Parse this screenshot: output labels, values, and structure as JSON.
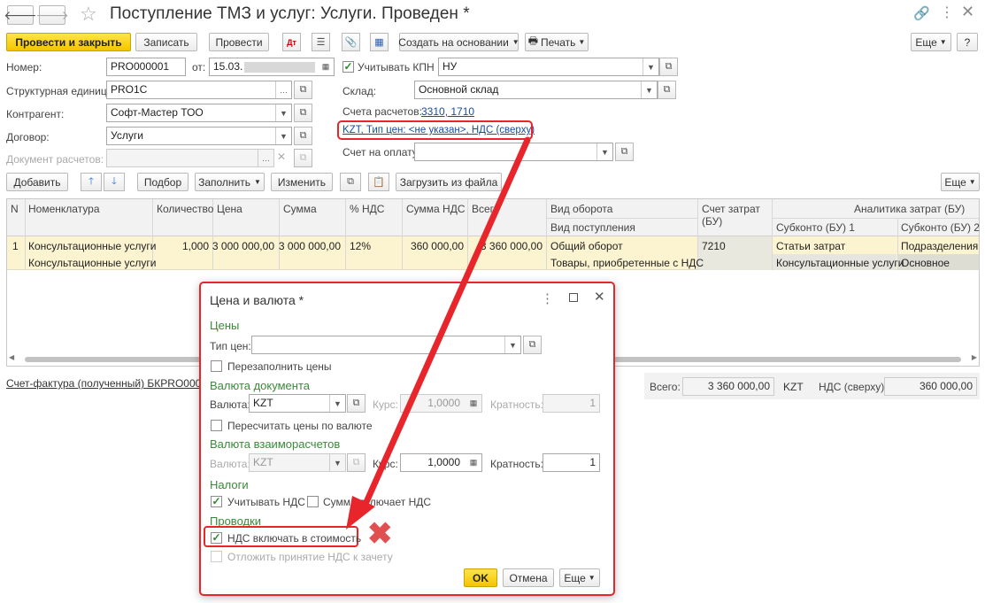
{
  "window": {
    "title": "Поступление ТМЗ и услуг: Услуги. Проведен *"
  },
  "toolbar": {
    "post_close": "Провести и закрыть",
    "save": "Записать",
    "post": "Провести",
    "create_based": "Создать на основании",
    "print": "Печать",
    "more": "Еще",
    "help": "?"
  },
  "form": {
    "number_label": "Номер:",
    "number_value": "PRO000001",
    "date_label": "от:",
    "date_value": "15.03.",
    "kpn_label": "Учитывать КПН",
    "kpn_value": "НУ",
    "unit_label": "Структурная единица:",
    "unit_value": "PRO1C",
    "warehouse_label": "Склад:",
    "warehouse_value": "Основной склад",
    "counterparty_label": "Контрагент:",
    "counterparty_value": "Софт-Мастер ТОО",
    "accounts_label": "Счета расчетов:",
    "accounts_value": "3310, 1710",
    "price_link": "KZT, Тип цен: <не указан>, НДС (сверху)",
    "contract_label": "Договор:",
    "contract_value": "Услуги",
    "settlement_doc_label": "Документ расчетов:",
    "invoice_label": "Счет на оплату:"
  },
  "table_toolbar": {
    "add": "Добавить",
    "pick": "Подбор",
    "fill": "Заполнить",
    "change": "Изменить",
    "load": "Загрузить из файла",
    "more": "Еще"
  },
  "table": {
    "headers": {
      "n": "N",
      "item": "Номенклатура",
      "qty": "Количество",
      "price": "Цена",
      "sum": "Сумма",
      "vat_rate": "% НДС",
      "vat_sum": "Сумма НДС",
      "total": "Всего",
      "turnover": "Вид оборота",
      "receipt": "Вид поступления",
      "cost_account": "Счет затрат",
      "cost_account2": "(БУ)",
      "analytics": "Аналитика затрат (БУ)",
      "sub1": "Субконто (БУ) 1",
      "sub2": "Субконто (БУ) 2"
    },
    "row": {
      "n": "1",
      "item": "Консультационные услуги",
      "item2": "Консультационные услуги",
      "qty": "1,000",
      "price": "3 000 000,00",
      "sum": "3 000 000,00",
      "vat_rate": "12%",
      "vat_sum": "360 000,00",
      "total": "3 360 000,00",
      "turnover": "Общий оборот",
      "receipt": "Товары, приобретенные с НДС",
      "cost_account": "7210",
      "sub1": "Статьи затрат",
      "sub1b": "Консультационные услуги",
      "sub2": "Подразделения",
      "sub2b": "Основное"
    }
  },
  "footer": {
    "invoice_link": "Счет-фактура (полученный) БКPRO000001",
    "total_label": "Всего:",
    "total_value": "3 360 000,00",
    "currency": "KZT",
    "vat_label": "НДС (сверху):",
    "vat_value": "360 000,00"
  },
  "dialog": {
    "title": "Цена и валюта *",
    "prices_section": "Цены",
    "price_type_label": "Тип цен:",
    "refill_prices": "Перезаполнить цены",
    "doc_currency_section": "Валюта документа",
    "currency_label": "Валюта:",
    "currency_value": "KZT",
    "rate_label": "Курс:",
    "rate_value": "1,0000",
    "multiplicity_label": "Кратность:",
    "multiplicity_value": "1",
    "recalc_prices": "Пересчитать цены по валюте",
    "settle_currency_section": "Валюта взаиморасчетов",
    "currency2_label": "Валюта:",
    "currency2_value": "KZT",
    "rate2_label": "Курс:",
    "rate2_value": "1,0000",
    "multiplicity2_label": "Кратность:",
    "multiplicity2_value": "1",
    "taxes_section": "Налоги",
    "consider_vat": "Учитывать НДС",
    "sum_includes_vat": "Сумма включает НДС",
    "postings_section": "Проводки",
    "vat_in_cost": "НДС включать в стоимость",
    "defer_vat": "Отложить принятие НДС к зачету",
    "ok": "OK",
    "cancel": "Отмена",
    "more": "Еще"
  },
  "colors": {
    "accent": "#f5c400",
    "highlight": "#e8252b",
    "row": "#fcf3d0"
  }
}
